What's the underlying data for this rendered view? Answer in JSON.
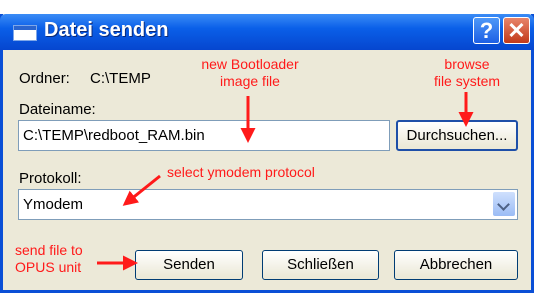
{
  "window": {
    "title": "Datei senden"
  },
  "titlebar": {
    "help_glyph": "?",
    "close_glyph": "✕"
  },
  "folder": {
    "label": "Ordner:",
    "value": "C:\\TEMP"
  },
  "filename": {
    "label": "Dateiname:",
    "value": "C:\\TEMP\\redboot_RAM.bin"
  },
  "protocol": {
    "label": "Protokoll:",
    "value": "Ymodem"
  },
  "buttons": {
    "browse": "Durchsuchen...",
    "send": "Senden",
    "close": "Schließen",
    "cancel": "Abbrechen"
  },
  "annotations": {
    "bootloader_line1": "new Bootloader",
    "bootloader_line2": "image file",
    "browse_line1": "browse",
    "browse_line2": "file system",
    "protocol_note": "select ymodem protocol",
    "send_line1": "send file to",
    "send_line2": "OPUS unit"
  },
  "colors": {
    "annotation": "#ff1a1a",
    "titlebar": "#0a5fe8",
    "dialog_bg": "#ece9d8"
  }
}
